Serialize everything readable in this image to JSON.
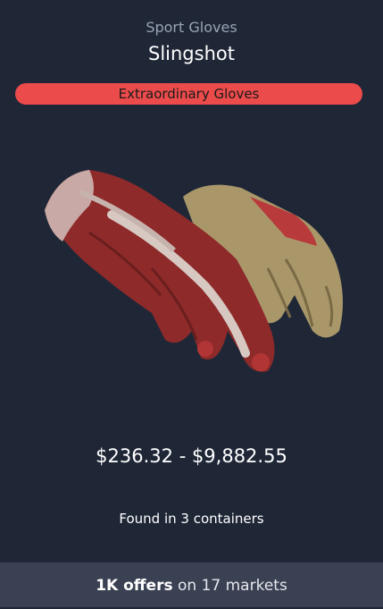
{
  "item": {
    "weapon": "Sport Gloves",
    "skin": "Slingshot",
    "rarity": "Extraordinary Gloves",
    "rarity_color": "#eb4b4b",
    "price_range": "$236.32 - $9,882.55",
    "containers_text": "Found in 3 containers",
    "image_icon": "gloves-image"
  },
  "footer": {
    "offers": "1K offers",
    "markets": "on 17 markets"
  }
}
